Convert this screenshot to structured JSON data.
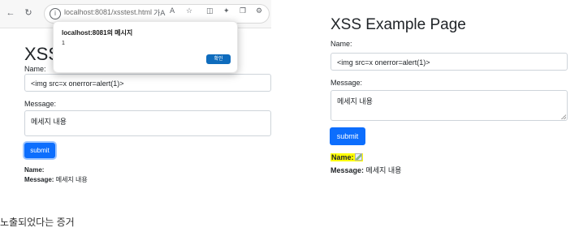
{
  "left_panel": {
    "browser": {
      "url": "localhost:8081/xsstest.html",
      "read_aloud_label": "가A",
      "text_size_label": "A",
      "icons": {
        "back": "back-arrow-icon",
        "reload": "reload-icon",
        "info": "info-icon",
        "favorite": "star-icon",
        "split": "split-screen-icon",
        "favorites_bar": "favorites-icon",
        "collections": "collections-icon",
        "extensions": "extensions-icon"
      }
    },
    "page": {
      "title": "XSS",
      "name_label": "Name:",
      "name_value": "<img src=x onerror=alert(1)>",
      "message_label": "Message:",
      "message_value": "메세지 내용",
      "submit_label": "submit",
      "output": {
        "name_label": "Name:",
        "message_label": "Message:",
        "message_value": "메세지 내용"
      }
    },
    "alert": {
      "title": "localhost:8081의 메시지",
      "message": "1",
      "ok_label": "확인"
    }
  },
  "right_panel": {
    "title": "XSS Example Page",
    "name_label": "Name:",
    "name_value": "<img src=x onerror=alert(1)>",
    "message_label": "Message:",
    "message_value": "메세지 내용",
    "submit_label": "submit",
    "output": {
      "name_label": "Name:",
      "message_label": "Message:",
      "message_value": "메세지 내용"
    }
  },
  "caption": "노출되었다는 증거",
  "colors": {
    "primary_button": "#0d6efd",
    "highlight": "#ffff00",
    "dialog_button": "#0f6cbd"
  }
}
